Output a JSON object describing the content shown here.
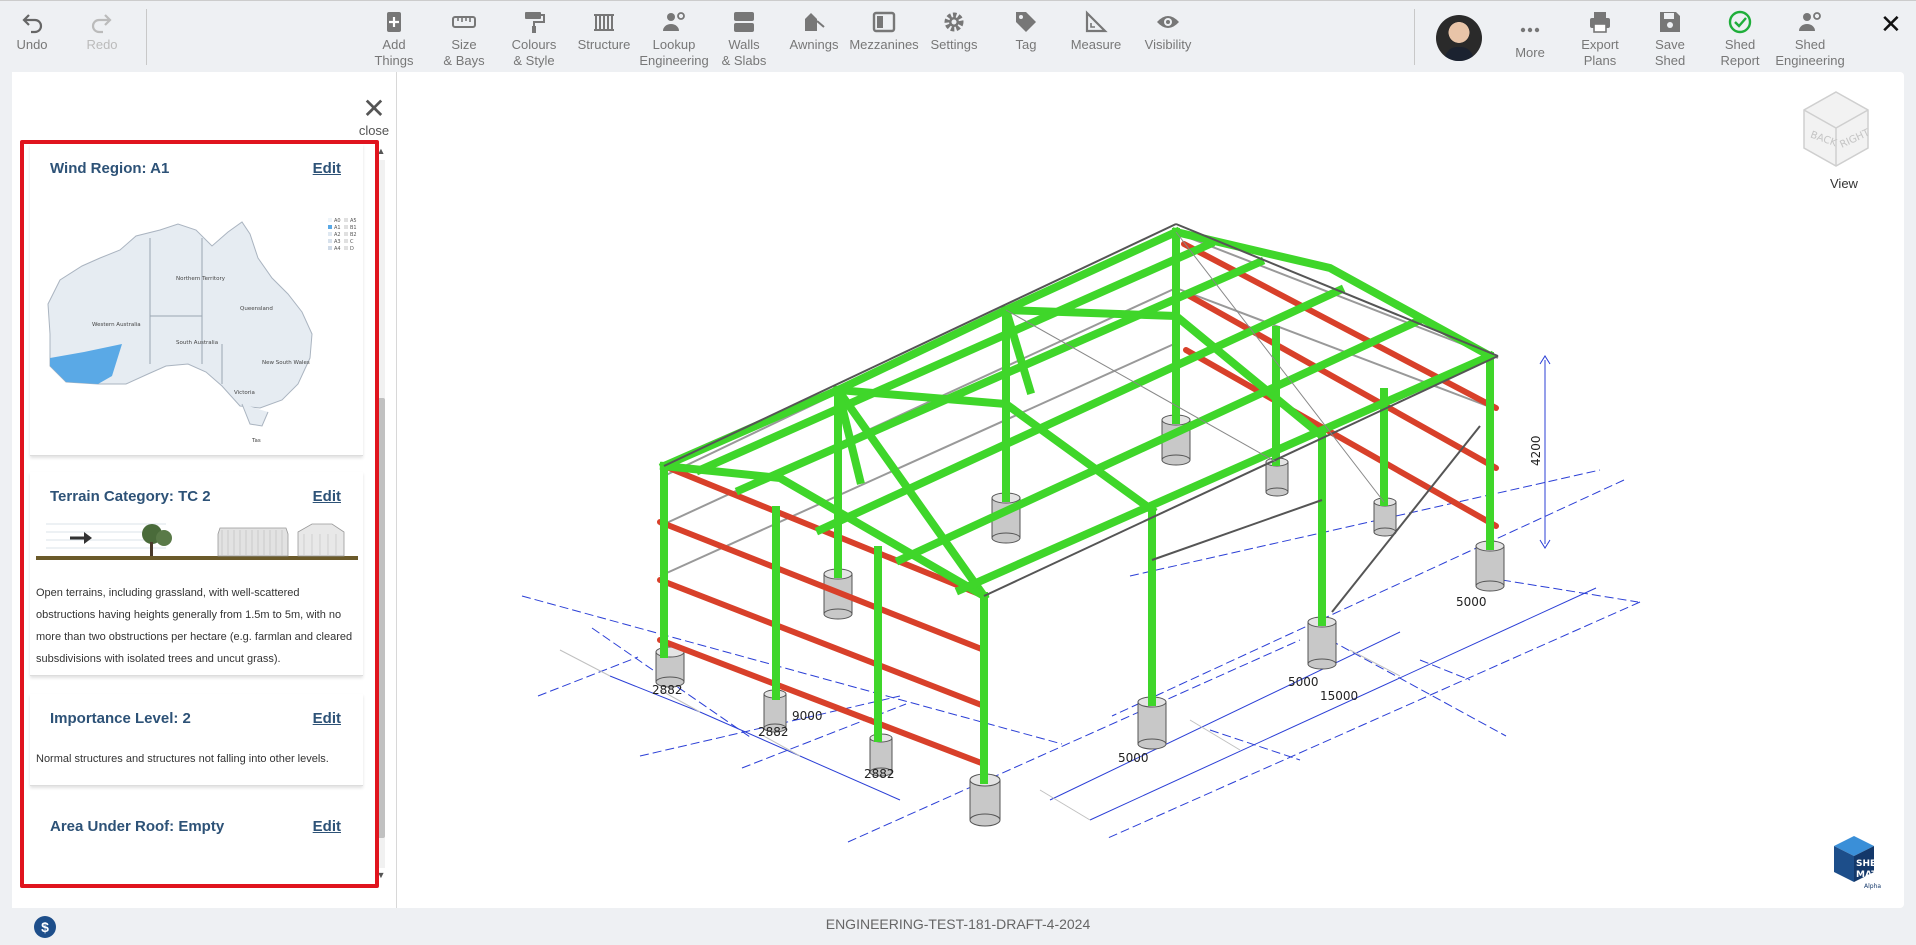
{
  "toolbar": {
    "undo": "Undo",
    "redo": "Redo",
    "items": [
      {
        "label": "Add\nThings",
        "icon": "add-things-icon"
      },
      {
        "label": "Size\n& Bays",
        "icon": "ruler-icon"
      },
      {
        "label": "Colours\n& Style",
        "icon": "paint-roller-icon"
      },
      {
        "label": "Structure",
        "icon": "structure-icon"
      },
      {
        "label": "Lookup\nEngineering",
        "icon": "engineer-icon"
      },
      {
        "label": "Walls\n& Slabs",
        "icon": "walls-icon"
      },
      {
        "label": "Awnings",
        "icon": "awning-icon"
      },
      {
        "label": "Mezzanines",
        "icon": "mezzanine-icon"
      },
      {
        "label": "Settings",
        "icon": "gear-icon"
      },
      {
        "label": "Tag",
        "icon": "tag-icon"
      },
      {
        "label": "Measure",
        "icon": "measure-icon"
      },
      {
        "label": "Visibility",
        "icon": "eye-icon"
      }
    ],
    "right_items": [
      {
        "label": "More",
        "icon": "more-icon"
      },
      {
        "label": "Export\nPlans",
        "icon": "printer-icon"
      },
      {
        "label": "Save\nShed",
        "icon": "save-icon"
      },
      {
        "label": "Shed\nReport",
        "icon": "check-circle-icon"
      },
      {
        "label": "Shed\nEngineering",
        "icon": "engineer-icon"
      }
    ]
  },
  "panel": {
    "close_label": "close",
    "cards": [
      {
        "title": "Wind Region: A1",
        "edit": "Edit"
      },
      {
        "title": "Terrain Category: TC 2",
        "edit": "Edit",
        "description": "Open terrains, including grassland, with well-scattered obstructions having heights generally from 1.5m to 5m, with no more than two obstructions per hectare (e.g. farmlan and cleared subsdivisions with isolated trees and uncut grass)."
      },
      {
        "title": "Importance Level: 2",
        "edit": "Edit",
        "description": "Normal structures and structures not falling into other levels."
      },
      {
        "title": "Area Under Roof: Empty",
        "edit": "Edit"
      }
    ],
    "map": {
      "legend": [
        "A0",
        "A1",
        "A2",
        "A3",
        "A4",
        "A5",
        "B1",
        "B2",
        "C",
        "D"
      ],
      "states": [
        "Northern Territory",
        "Queensland",
        "Western Australia",
        "South Australia",
        "New South Wales",
        "Victoria",
        "Tas"
      ]
    }
  },
  "viewport": {
    "dimensions": [
      "4200",
      "5000",
      "5000",
      "15000",
      "5000",
      "2882",
      "2882",
      "9000",
      "2882"
    ],
    "view_cube_faces": [
      "BACK",
      "RIGHT"
    ],
    "view_label": "View"
  },
  "logo": {
    "line1": "SHED",
    "line2": "MATE",
    "line3": "Alpha"
  },
  "footer": {
    "title": "ENGINEERING-TEST-181-DRAFT-4-2024",
    "dollar": "$"
  },
  "colors": {
    "accent": "#2d5277",
    "frame_green": "#3fd62a",
    "purlin_red": "#d8402a",
    "highlight": "#e0141e"
  }
}
